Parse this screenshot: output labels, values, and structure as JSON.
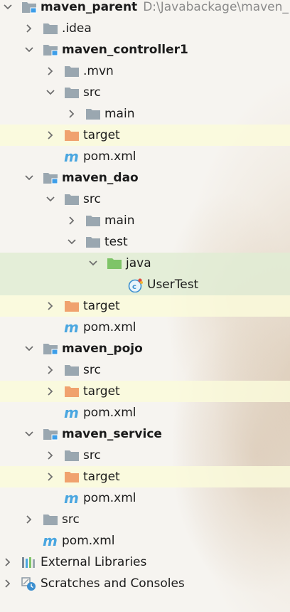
{
  "project_tree": {
    "rows": [
      {
        "label": "maven_parent",
        "path": "D:\\Javabackage\\maven_",
        "bold": true,
        "level": 0,
        "arrow": "down",
        "icon": "module-folder-icon",
        "highlight": ""
      },
      {
        "label": ".idea",
        "level": 1,
        "arrow": "right",
        "icon": "folder-icon",
        "highlight": ""
      },
      {
        "label": "maven_controller1",
        "bold": true,
        "level": 1,
        "arrow": "down",
        "icon": "module-folder-icon",
        "highlight": ""
      },
      {
        "label": ".mvn",
        "level": 2,
        "arrow": "right",
        "icon": "folder-icon",
        "highlight": ""
      },
      {
        "label": "src",
        "level": 2,
        "arrow": "down",
        "icon": "folder-icon",
        "highlight": ""
      },
      {
        "label": "main",
        "level": 3,
        "arrow": "right",
        "icon": "folder-icon",
        "highlight": ""
      },
      {
        "label": "target",
        "level": 2,
        "arrow": "right",
        "icon": "excluded-folder-icon",
        "highlight": "yellow"
      },
      {
        "label": "pom.xml",
        "level": 2,
        "arrow": "none",
        "icon": "maven-file-icon",
        "highlight": ""
      },
      {
        "label": "maven_dao",
        "bold": true,
        "level": 1,
        "arrow": "down",
        "icon": "module-folder-icon",
        "highlight": ""
      },
      {
        "label": "src",
        "level": 2,
        "arrow": "down",
        "icon": "folder-icon",
        "highlight": ""
      },
      {
        "label": "main",
        "level": 3,
        "arrow": "right",
        "icon": "folder-icon",
        "highlight": ""
      },
      {
        "label": "test",
        "level": 3,
        "arrow": "down",
        "icon": "folder-icon",
        "highlight": ""
      },
      {
        "label": "java",
        "level": 4,
        "arrow": "down",
        "icon": "test-source-folder-icon",
        "highlight": "green"
      },
      {
        "label": "UserTest",
        "level": 5,
        "arrow": "none",
        "icon": "java-class-icon",
        "highlight": "green"
      },
      {
        "label": "target",
        "level": 2,
        "arrow": "right",
        "icon": "excluded-folder-icon",
        "highlight": "yellow"
      },
      {
        "label": "pom.xml",
        "level": 2,
        "arrow": "none",
        "icon": "maven-file-icon",
        "highlight": ""
      },
      {
        "label": "maven_pojo",
        "bold": true,
        "level": 1,
        "arrow": "down",
        "icon": "module-folder-icon",
        "highlight": ""
      },
      {
        "label": "src",
        "level": 2,
        "arrow": "right",
        "icon": "folder-icon",
        "highlight": ""
      },
      {
        "label": "target",
        "level": 2,
        "arrow": "right",
        "icon": "excluded-folder-icon",
        "highlight": "yellow"
      },
      {
        "label": "pom.xml",
        "level": 2,
        "arrow": "none",
        "icon": "maven-file-icon",
        "highlight": ""
      },
      {
        "label": "maven_service",
        "bold": true,
        "level": 1,
        "arrow": "down",
        "icon": "module-folder-icon",
        "highlight": ""
      },
      {
        "label": "src",
        "level": 2,
        "arrow": "right",
        "icon": "folder-icon",
        "highlight": ""
      },
      {
        "label": "target",
        "level": 2,
        "arrow": "right",
        "icon": "excluded-folder-icon",
        "highlight": "yellow"
      },
      {
        "label": "pom.xml",
        "level": 2,
        "arrow": "none",
        "icon": "maven-file-icon",
        "highlight": ""
      },
      {
        "label": "src",
        "level": 1,
        "arrow": "right",
        "icon": "folder-icon",
        "highlight": ""
      },
      {
        "label": "pom.xml",
        "level": 1,
        "arrow": "none",
        "icon": "maven-file-icon",
        "highlight": ""
      },
      {
        "label": "External Libraries",
        "level": 0,
        "arrow": "right",
        "icon": "libraries-icon",
        "highlight": ""
      },
      {
        "label": "Scratches and Consoles",
        "level": 0,
        "arrow": "right",
        "icon": "scratches-icon",
        "highlight": ""
      }
    ]
  },
  "colors": {
    "folder": "#9aa7b0",
    "module_badge": "#3d9ee8",
    "excluded_folder": "#f0a26e",
    "test_source_folder": "#7ec468",
    "maven_m": "#4aa6e0",
    "arrow": "#6e6e6e",
    "highlight_yellow": "#fafada",
    "highlight_green": "#e1ecd4"
  }
}
